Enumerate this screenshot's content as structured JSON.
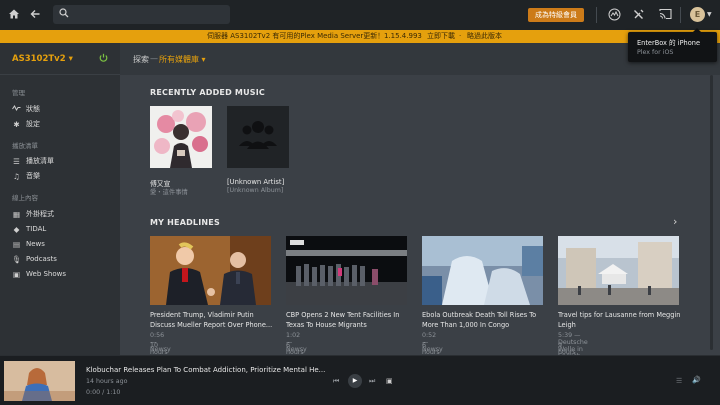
{
  "topbar": {
    "home_icon": "home-icon",
    "back_icon": "back-arrow-icon",
    "search_icon": "search-icon",
    "search_placeholder": "",
    "premium_label": "成為特級會員",
    "activity_icon": "activity-icon",
    "settings_icon": "wrench-icon",
    "cast_icon": "cast-icon",
    "avatar_letter": "E"
  },
  "notice": {
    "message": "伺服器 AS3102Tv2 有可用的Plex Media Server更新！",
    "version": "1.15.4.993",
    "download": "立即下載",
    "skip": "略過此版本"
  },
  "popup": {
    "device": "EnterBox 的 iPhone",
    "app": "Plex for iOS"
  },
  "sidebar": {
    "server": "AS3102Tv2",
    "manage_label": "管理",
    "manage_items": [
      {
        "label": "狀態",
        "icon": "activity-icon"
      },
      {
        "label": "設定",
        "icon": "gear-icon"
      }
    ],
    "playlists_label": "播放清單",
    "playlist_items": [
      {
        "label": "播放清單",
        "icon": "list-icon"
      },
      {
        "label": "音樂",
        "icon": "music-note-icon"
      }
    ],
    "online_label": "線上內容",
    "online_items": [
      {
        "label": "外掛程式",
        "icon": "grid-icon"
      },
      {
        "label": "TIDAL",
        "icon": "tidal-icon"
      },
      {
        "label": "News",
        "icon": "news-icon"
      },
      {
        "label": "Podcasts",
        "icon": "microphone-icon"
      },
      {
        "label": "Web Shows",
        "icon": "web-shows-icon"
      }
    ]
  },
  "breadcrumb": {
    "explore": "探索",
    "sep": "—",
    "library": "所有媒體庫"
  },
  "recent_music": {
    "title": "RECENTLY ADDED MUSIC",
    "items": [
      {
        "title": "傅又宣",
        "subtitle": "愛・這件事情"
      },
      {
        "title": "[Unknown Artist]",
        "subtitle": "[Unknown Album]"
      }
    ]
  },
  "headlines": {
    "title": "MY HEADLINES",
    "items": [
      {
        "title": "President Trump, Vladimir Putin Discuss Mueller Report Over Phone...",
        "meta": "0:56 — Newsy",
        "age": "10 hours ago"
      },
      {
        "title": "CBP Opens 2 New Tent Facilities In Texas To House Migrants",
        "meta": "1:02 — Newsy",
        "age": "6 hours ago"
      },
      {
        "title": "Ebola Outbreak Death Toll Rises To More Than 1,000 In Congo",
        "meta": "0:52 — Newsy",
        "age": "6 hours ago"
      },
      {
        "title": "Travel tips for Lausanne from Meggin Leigh",
        "meta": "5:39 — Deutsche Welle in English",
        "age": "9 hours ago"
      }
    ]
  },
  "player": {
    "title": "Klobuchar Releases Plan To Combat Addiction, Prioritize Mental He...",
    "age": "14 hours ago",
    "time": "0:00 / 1:10"
  },
  "colors": {
    "accent": "#e5a00d",
    "premium": "#cc7b19",
    "power": "#7cc242"
  }
}
